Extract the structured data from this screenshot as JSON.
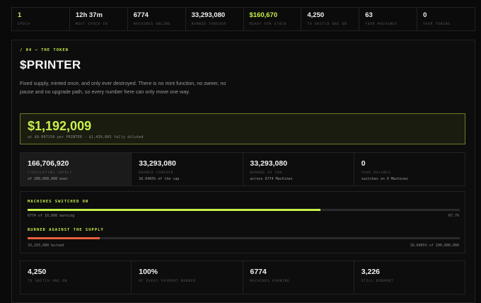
{
  "topbar": [
    {
      "value": "1",
      "label": "EPOCH",
      "green": true
    },
    {
      "value": "12h 37m",
      "label": "NEXT EPOCH IN",
      "green": false
    },
    {
      "value": "6774",
      "label": "MACHINES ONLINE",
      "green": false
    },
    {
      "value": "33,293,080",
      "label": "BURNED FOREVER",
      "green": false
    },
    {
      "value": "$160,670",
      "label": "READY FOR STOCK",
      "green": true
    },
    {
      "value": "4,250",
      "label": "TO SWITCH ONE ON",
      "green": false
    },
    {
      "value": "63",
      "label": "YOUR MACHINES",
      "green": false
    },
    {
      "value": "0",
      "label": "YOUR TOKENS",
      "green": false
    }
  ],
  "token": {
    "eyebrow": "/ 04 — THE TOKEN",
    "title": "$PRINTER",
    "description": "Fixed supply, minted once, and only ever destroyed. There is no mint function, no owner, no pause and no upgrade path, so every number here can only move one way."
  },
  "price": {
    "value": "$1,192,009",
    "sub": "at $0.007150 per PRINTER · $1,430,065 fully diluted"
  },
  "supply_row": [
    {
      "value": "166,706,920",
      "label": "CIRCULATING SUPPLY",
      "sub": "of 200,000,000 ever"
    },
    {
      "value": "33,293,080",
      "label": "BURNED FOREVER",
      "sub": "16.6465% of the cap"
    },
    {
      "value": "33,293,080",
      "label": "BURNED AS INK",
      "sub": "across 6774 Machines"
    },
    {
      "value": "0",
      "label": "YOUR BALANCE",
      "sub": "switches on 0 Machines"
    }
  ],
  "bars": {
    "machines_label": "MACHINES SWITCHED ON",
    "machines_fraction": 0.677,
    "machines_left": "6774 of 10,000 earning",
    "machines_right": "67.7%",
    "machines_color": "#c8f04a",
    "burn_label": "BURNED AGAINST THE SUPPLY",
    "burn_fraction": 0.166465,
    "burn_left": "33,293,080 burned",
    "burn_right": "16.6465% of 200,000,000",
    "burn_color": "#e8603c"
  },
  "bottom_row": [
    {
      "value": "4,250",
      "label": "TO SWITCH ONE ON"
    },
    {
      "value": "100%",
      "label": "OF EVERY PAYMENT BURNED"
    },
    {
      "value": "6774",
      "label": "MACHINES EARNING"
    },
    {
      "value": "3,226",
      "label": "STILL DORMANT"
    }
  ]
}
